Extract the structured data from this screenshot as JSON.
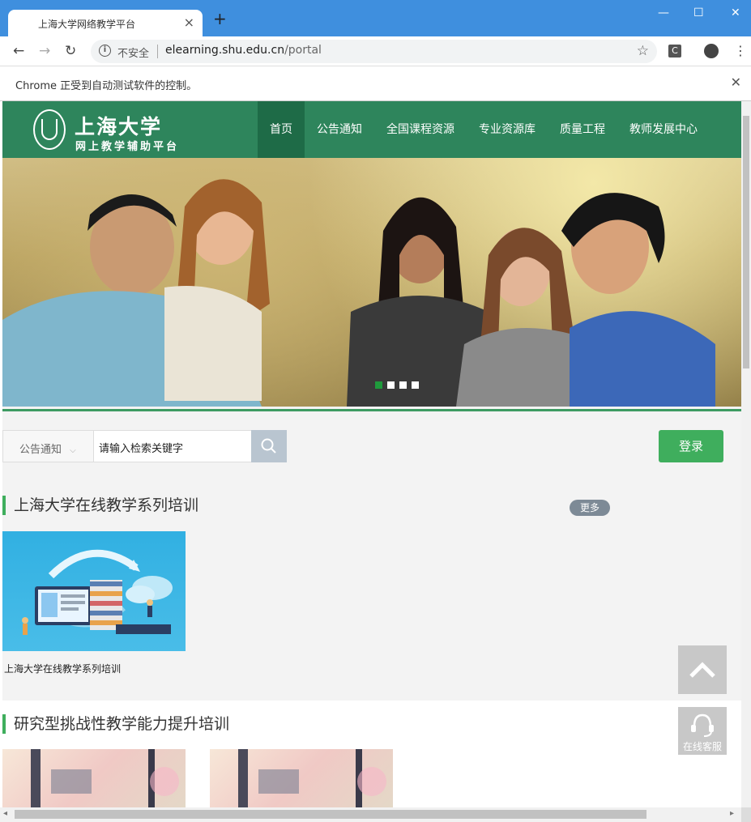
{
  "browser": {
    "tab_title": "上海大学网络教学平台",
    "tab_close": "×",
    "new_tab": "+",
    "window_controls": {
      "minimize": "—",
      "maximize": "☐",
      "close": "✕"
    },
    "security_label": "不安全",
    "url_host": "elearning.shu.edu.cn",
    "url_path": "/portal",
    "infobar_text": "Chrome 正受到自动测试软件的控制。",
    "infobar_close": "✕",
    "extension_letter": "C",
    "nav_back": "←",
    "nav_forward": "→",
    "nav_reload": "↻",
    "bookmark_star": "☆",
    "menu": "⋮"
  },
  "site": {
    "logo_title": "上海大学",
    "logo_subtitle": "网上教学辅助平台",
    "nav": [
      {
        "label": "首页",
        "active": true
      },
      {
        "label": "公告通知"
      },
      {
        "label": "全国课程资源"
      },
      {
        "label": "专业资源库"
      },
      {
        "label": "质量工程"
      },
      {
        "label": "教师发展中心"
      }
    ],
    "carousel": {
      "slides": 4,
      "active_index": 0
    },
    "search": {
      "category": "公告通知",
      "placeholder": "请输入检索关键字"
    },
    "login_label": "登录",
    "sections": [
      {
        "title": "上海大学在线教学系列培训",
        "more_label": "更多",
        "cards": [
          {
            "caption": "上海大学在线教学系列培训"
          }
        ]
      },
      {
        "title": "研究型挑战性教学能力提升培训",
        "cards": [
          {
            "caption": ""
          },
          {
            "caption": ""
          }
        ]
      }
    ],
    "back_to_top_icon": "chevron-up",
    "support_label": "在线客服",
    "accent_color": "#2e855c",
    "login_color": "#3fae5d"
  }
}
